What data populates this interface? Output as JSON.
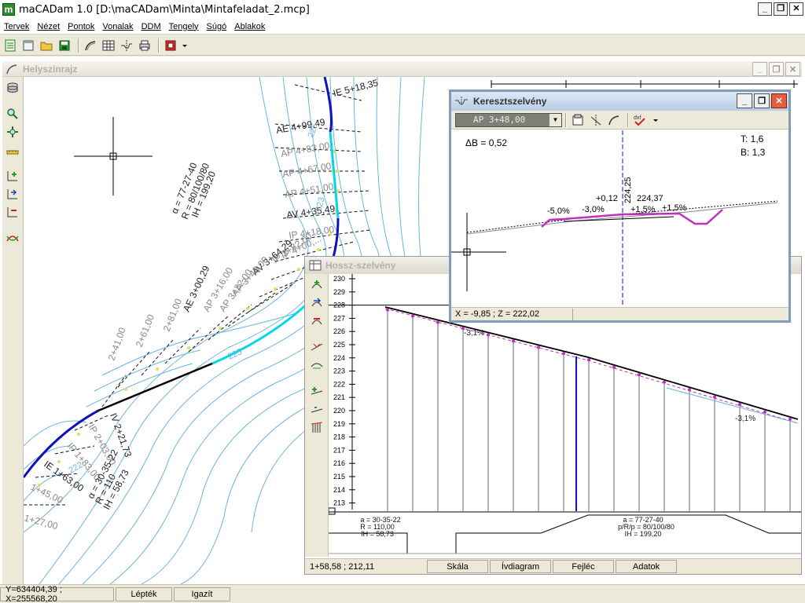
{
  "app": {
    "title": "maCADam 1.0 [D:\\maCADam\\Minta\\Mintafeladat_2.mcp]",
    "icon_letter": "m"
  },
  "window_controls": {
    "minimize": "_",
    "restore": "❐",
    "close": "✕"
  },
  "menu": [
    {
      "label": "Tervek"
    },
    {
      "label": "Nézet"
    },
    {
      "label": "Pontok"
    },
    {
      "label": "Vonalak"
    },
    {
      "label": "DDM"
    },
    {
      "label": "Tengely"
    },
    {
      "label": "Súgó"
    },
    {
      "label": "Ablakok"
    }
  ],
  "toolbar_icons": [
    "new-plan-icon",
    "open-plan-icon",
    "open-folder-icon",
    "save-icon",
    "axis-icon",
    "table-icon",
    "cross-section-icon",
    "print-icon",
    "layers-icon",
    "dropdown-arrow-icon"
  ],
  "site_plan": {
    "title": "Helyszínrajz",
    "labels": {
      "ie_5": "IE 5+18,35",
      "ae_4_99": "AE 4+99,49",
      "ap_4_83": "AP 4+83,00",
      "ap_4_67": "AP 4+67,00",
      "ap_4_51": "AP 4+51,00",
      "av_4_35": "AV 4+35,49",
      "ip_4_18": "IP 4+18,00",
      "ip_4_00": "IP 4+00,...",
      "ip_3_82": "IP 3+82,00",
      "av_3_64": "AV 3+64,29",
      "ap_3_48": "AP 3+48,00",
      "ap_3_32": "AP 3+32,00",
      "ap_3_16": "AP 3+16,00",
      "ae_3_00": "AE 3+00,29",
      "s_2_81": "2+81,00",
      "s_2_61": "2+61,00",
      "s_2_41": "2+41,00",
      "iv_2_21": "IV 2+21,73",
      "ip_2_03": "IP 2+03,00",
      "ip_1_83": "IP 1+83,00",
      "ie_1_63": "IE 1+63,00",
      "s_1_45": "1+45,00",
      "s_1_27": "1+27,00",
      "s_225": "225",
      "s_223": "223",
      "s_222": "222"
    },
    "curve_upper": {
      "alpha": "α = 77-27-40",
      "r": "R = 80/100/80",
      "ih": "IH = 199,20"
    },
    "curve_lower": {
      "alpha": "α = 30-35-22",
      "r": "R = 110",
      "ih": "IH = 58,73"
    }
  },
  "cross_section": {
    "title": "Keresztszelvény",
    "station": "AP  3+48,00",
    "delta_b": "ΔB = 0,52",
    "t": "T: 1,6",
    "b": "B: 1,3",
    "height": "224,25",
    "height2": "224,37",
    "offset": "+0,12",
    "slopes": [
      "-5,0%",
      "-3,0%",
      "+1,5%",
      "+1,5%"
    ],
    "status": "X = -9,85 ; Z = 222,02",
    "toolbar_icons": [
      "properties-icon",
      "axis-tool-icon",
      "curve-tool-icon",
      "dxf-export-icon"
    ],
    "dxf_label": "dxf"
  },
  "long_section": {
    "title": "Hossz-szelvény",
    "y_ticks": [
      "230",
      "229",
      "228",
      "227",
      "226",
      "225",
      "224",
      "223",
      "222",
      "221",
      "220",
      "219",
      "218",
      "217",
      "216",
      "215",
      "214",
      "213"
    ],
    "grade_left": "-3,1%",
    "grade_right": "-3,1%",
    "curve_left": {
      "a": "a = 30-35-22",
      "r": "R = 110,00",
      "ih": "IH = 58,73"
    },
    "curve_right": {
      "a": "a = 77-27-40",
      "prp": "p/R/p = 80/100/80",
      "ih": "IH = 199,20"
    },
    "status": {
      "coord": "1+58,58 ; 212,11",
      "buttons": [
        "Skála",
        "Ívdiagram",
        "Fejléc",
        "Adatok"
      ]
    }
  },
  "statusbar": {
    "coord": "Y=634404,39 ; X=255568,20",
    "scale": "Lépték",
    "align": "Igazít"
  },
  "colors": {
    "axis_blue": "#1010c0",
    "cyan": "#00d8e8",
    "contour": "#6ab4e0",
    "magenta": "#c030c0",
    "yellow": "#e0e060"
  }
}
